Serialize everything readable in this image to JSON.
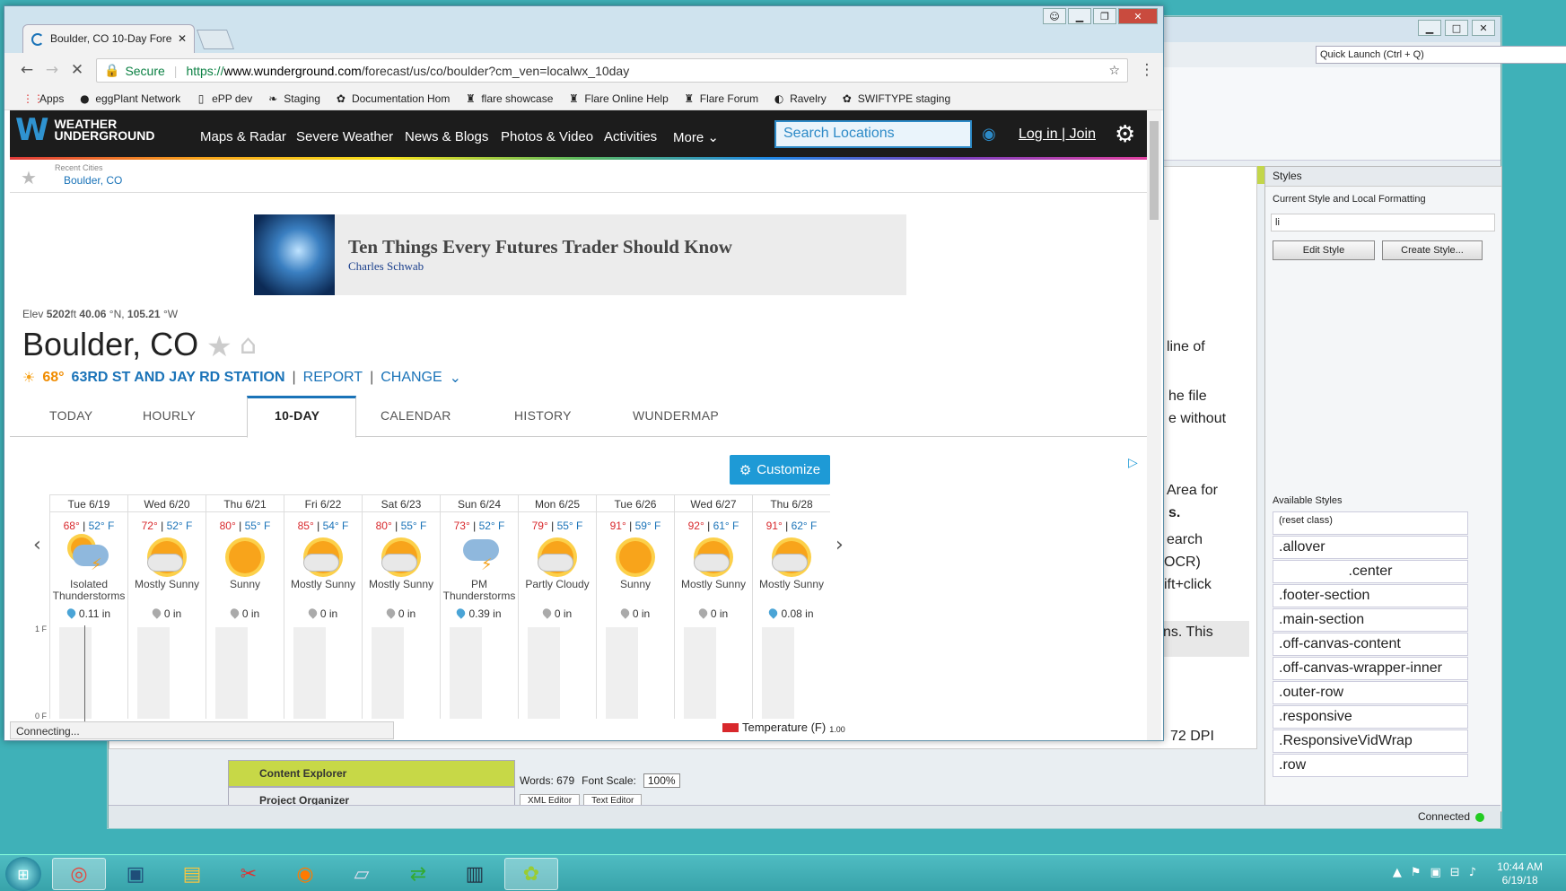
{
  "flare": {
    "quick_launch_placeholder": "Quick Launch (Ctrl + Q)",
    "doc_fragments": [
      "line of",
      "he file",
      "e without",
      "Area for",
      "s.",
      "earch",
      "OCR)",
      "ift+click",
      "ns. This",
      "72 DPI"
    ],
    "styles_panel": {
      "title": "Styles",
      "current_label": "Current Style and Local Formatting",
      "current_value": "li",
      "edit_button": "Edit Style",
      "create_button": "Create Style...",
      "available_label": "Available Styles",
      "items": [
        "(reset class)",
        ".allover",
        ".center",
        ".footer-section",
        ".main-section",
        ".off-canvas-content",
        ".off-canvas-wrapper-inner",
        ".outer-row",
        ".responsive",
        ".ResponsiveVidWrap",
        ".row"
      ]
    },
    "content_explorer": "Content Explorer",
    "project_organizer": "Project Organizer",
    "words": "Words: 679",
    "font_scale_label": "Font Scale:",
    "zoom": "100%",
    "tab_xml": "XML Editor",
    "tab_text": "Text Editor",
    "connected": "Connected"
  },
  "chrome": {
    "tab_title": "Boulder, CO 10-Day Fore",
    "secure": "Secure",
    "url_scheme": "https://",
    "url_host": "www.wunderground.com",
    "url_path": "/forecast/us/co/boulder?cm_ven=localwx_10day",
    "bookmarks": [
      {
        "label": "Apps",
        "icon": "apps-grid-icon"
      },
      {
        "label": "eggPlant Network",
        "icon": "eggplant-icon"
      },
      {
        "label": "ePP dev",
        "icon": "page-icon"
      },
      {
        "label": "Staging",
        "icon": "leaf-icon"
      },
      {
        "label": "Documentation Hom",
        "icon": "flare-icon"
      },
      {
        "label": "flare showcase",
        "icon": "madcap-icon"
      },
      {
        "label": "Flare Online Help",
        "icon": "madcap-icon"
      },
      {
        "label": "Flare Forum",
        "icon": "madcap-icon"
      },
      {
        "label": "Ravelry",
        "icon": "ravelry-icon"
      },
      {
        "label": "SWIFTYPE staging",
        "icon": "flare-icon"
      }
    ],
    "status": "Connecting..."
  },
  "wu": {
    "logo_line1": "WEATHER",
    "logo_line2": "UNDERGROUND",
    "nav": [
      "Maps & Radar",
      "Severe Weather",
      "News & Blogs",
      "Photos & Video",
      "Activities",
      "More"
    ],
    "search_placeholder": "Search Locations",
    "login": "Log in",
    "join": "Join",
    "recent_label": "Recent Cities",
    "recent_city": "Boulder, CO",
    "ad_title": "Ten Things Every Futures Trader Should Know",
    "ad_sub": "Charles Schwab",
    "elev_prefix": "Elev ",
    "elev_value": "5202",
    "elev_unit": "ft ",
    "lat": "40.06",
    "lat_unit": " °N, ",
    "lon": "105.21",
    "lon_unit": " °W",
    "city": "Boulder, CO",
    "station_temp": "68°",
    "station_name": "63RD ST AND JAY RD STATION",
    "report": "REPORT",
    "change": "CHANGE",
    "tabs": [
      "TODAY",
      "HOURLY",
      "10-DAY",
      "CALENDAR",
      "HISTORY",
      "WUNDERMAP"
    ],
    "customize": "Customize",
    "days": [
      {
        "date": "Tue 6/19",
        "hi": "68°",
        "lo": "52° F",
        "cond": "Isolated Thunderstorms",
        "precip": "0.11 in",
        "icon": "partly-cloudy-thunderstorm-icon",
        "wet": true
      },
      {
        "date": "Wed 6/20",
        "hi": "72°",
        "lo": "52° F",
        "cond": "Mostly Sunny",
        "precip": "0 in",
        "icon": "mostly-sunny-icon",
        "wet": false
      },
      {
        "date": "Thu 6/21",
        "hi": "80°",
        "lo": "55° F",
        "cond": "Sunny",
        "precip": "0 in",
        "icon": "sunny-icon",
        "wet": false
      },
      {
        "date": "Fri 6/22",
        "hi": "85°",
        "lo": "54° F",
        "cond": "Mostly Sunny",
        "precip": "0 in",
        "icon": "mostly-sunny-icon",
        "wet": false
      },
      {
        "date": "Sat 6/23",
        "hi": "80°",
        "lo": "55° F",
        "cond": "Mostly Sunny",
        "precip": "0 in",
        "icon": "mostly-sunny-icon",
        "wet": false
      },
      {
        "date": "Sun 6/24",
        "hi": "73°",
        "lo": "52° F",
        "cond": "PM Thunderstorms",
        "precip": "0.39 in",
        "icon": "thunderstorm-icon",
        "wet": true
      },
      {
        "date": "Mon 6/25",
        "hi": "79°",
        "lo": "55° F",
        "cond": "Partly Cloudy",
        "precip": "0 in",
        "icon": "partly-cloudy-icon",
        "wet": false
      },
      {
        "date": "Tue 6/26",
        "hi": "91°",
        "lo": "59° F",
        "cond": "Sunny",
        "precip": "0 in",
        "icon": "sunny-icon",
        "wet": false
      },
      {
        "date": "Wed 6/27",
        "hi": "92°",
        "lo": "61° F",
        "cond": "Mostly Sunny",
        "precip": "0 in",
        "icon": "mostly-sunny-icon",
        "wet": false
      },
      {
        "date": "Thu 6/28",
        "hi": "91°",
        "lo": "62° F",
        "cond": "Mostly Sunny",
        "precip": "0.08 in",
        "icon": "mostly-sunny-icon",
        "wet": true
      }
    ],
    "axis_top": "1 F",
    "axis_bottom": "0 F",
    "legend": "Temperature (F)",
    "legend_value": "1.00"
  },
  "taskbar": {
    "apps": [
      "chrome-icon",
      "app-icon",
      "folder-icon",
      "snipping-tool-icon",
      "firefox-icon",
      "notepad-icon",
      "network-icon",
      "terminal-icon",
      "flare-icon"
    ],
    "time": "10:44 AM",
    "date": "6/19/18"
  },
  "colors": {
    "wu_blue": "#1a73b8",
    "hi_red": "#d8282c",
    "accent_orange": "#f08c00",
    "flare_green": "#c7d847"
  }
}
